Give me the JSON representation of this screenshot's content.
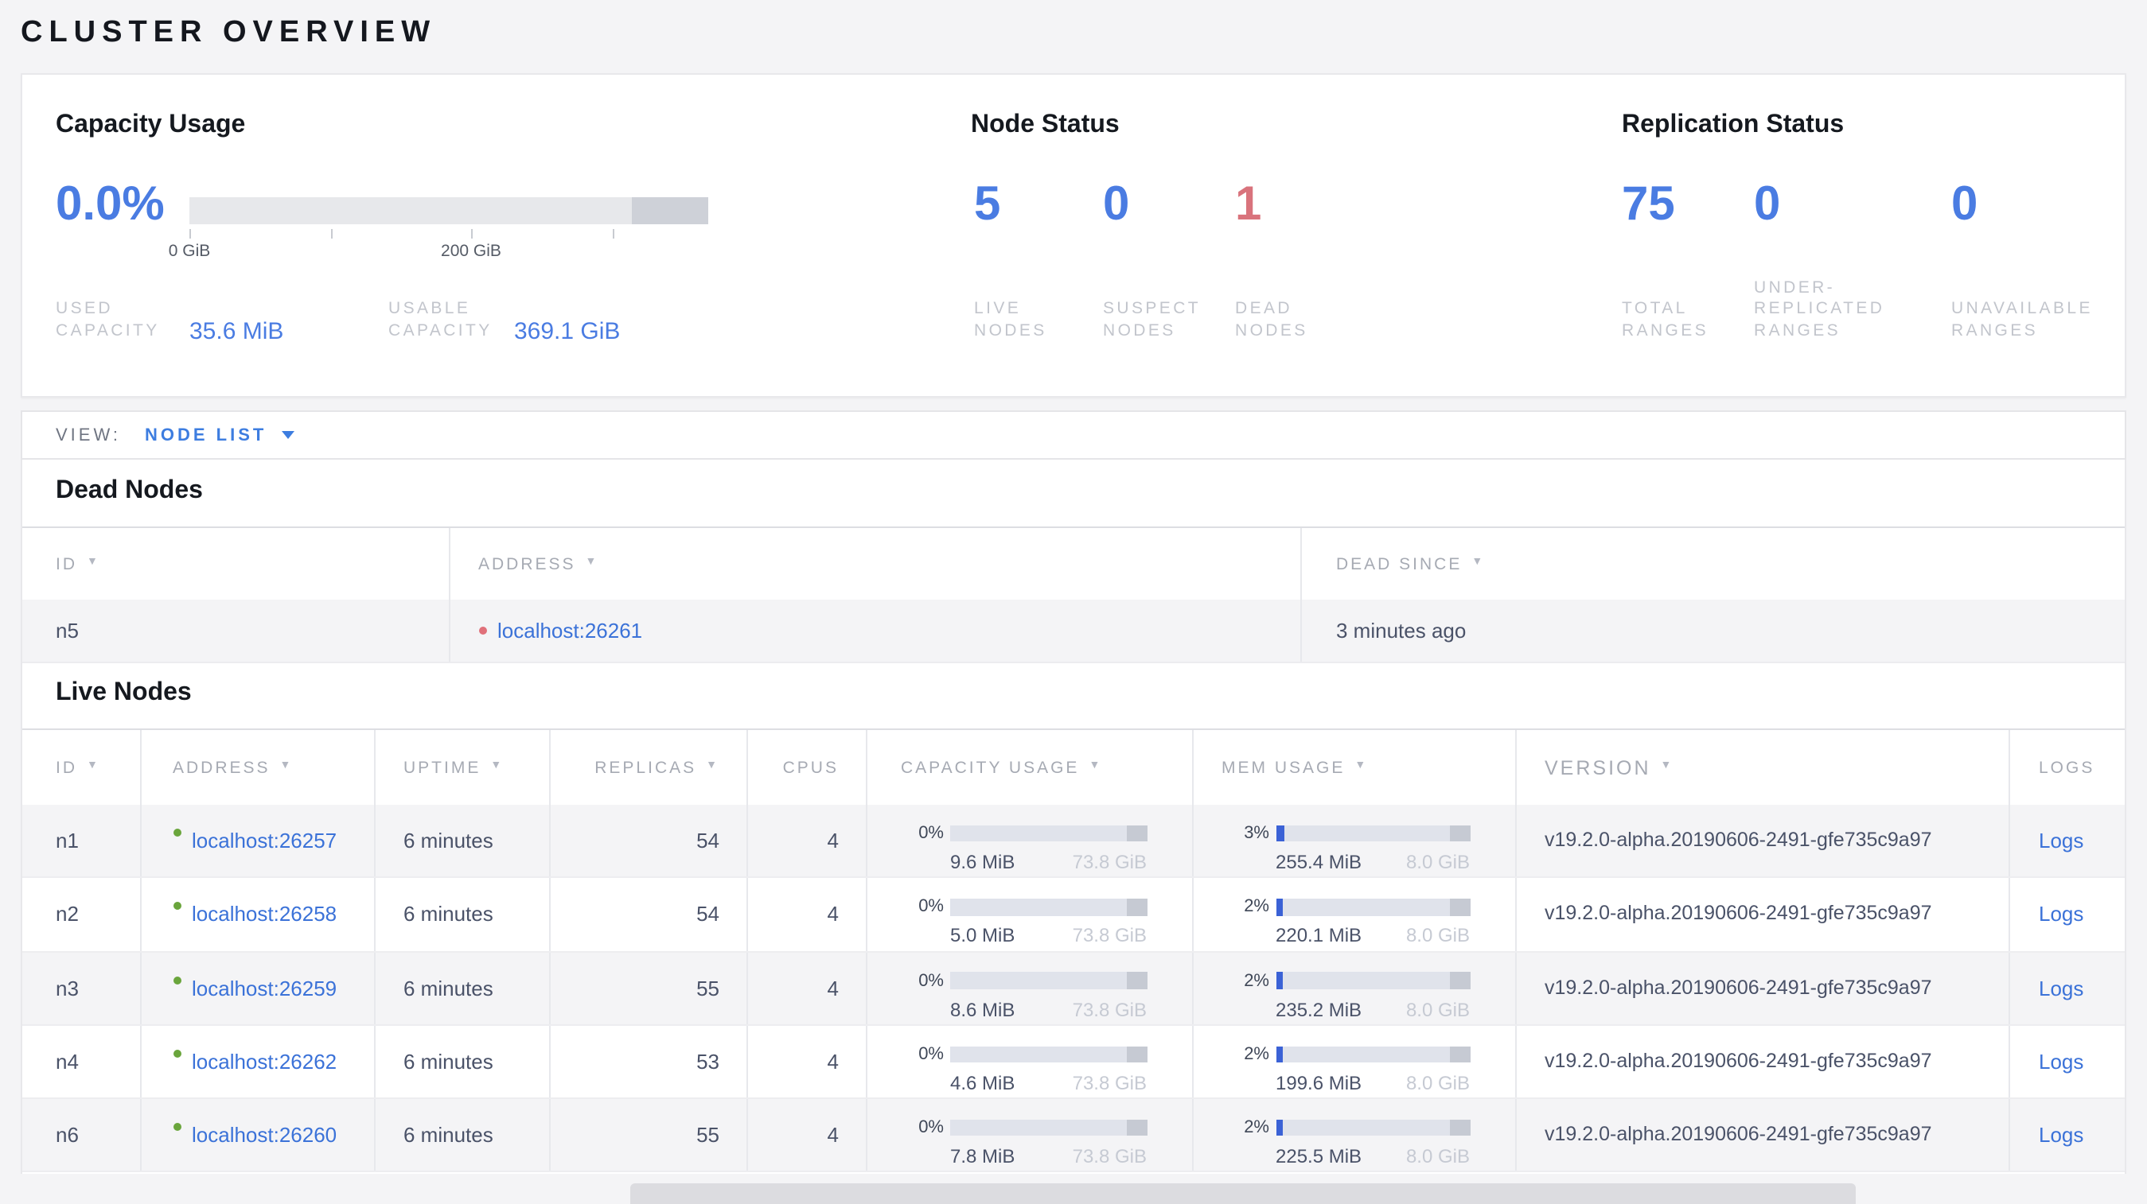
{
  "page": {
    "title": "CLUSTER OVERVIEW"
  },
  "colors": {
    "accent_blue": "#4a7ce2",
    "link_blue": "#3b72d8",
    "danger_red": "#d9737c",
    "live_green": "#6aa53c",
    "dead_dot_red": "#e0707a"
  },
  "summary": {
    "capacity": {
      "title": "Capacity Usage",
      "percent": "0.0%",
      "tick_labels": [
        "0 GiB",
        "200 GiB"
      ],
      "used": {
        "label": "USED\nCAPACITY",
        "value": "35.6 MiB"
      },
      "usable": {
        "label": "USABLE\nCAPACITY",
        "value": "369.1 GiB"
      }
    },
    "node_status": {
      "title": "Node Status",
      "stats": [
        {
          "value": "5",
          "label": "LIVE\nNODES"
        },
        {
          "value": "0",
          "label": "SUSPECT\nNODES"
        },
        {
          "value": "1",
          "label": "DEAD\nNODES"
        }
      ]
    },
    "replication": {
      "title": "Replication Status",
      "stats": [
        {
          "value": "75",
          "label": "TOTAL\nRANGES"
        },
        {
          "value": "0",
          "label": "UNDER-\nREPLICATED\nRANGES"
        },
        {
          "value": "0",
          "label": "UNAVAILABLE\nRANGES"
        }
      ]
    }
  },
  "view_bar": {
    "label": "VIEW:",
    "selected": "NODE LIST"
  },
  "dead_nodes": {
    "title": "Dead Nodes",
    "columns": [
      {
        "label": "ID"
      },
      {
        "label": "ADDRESS"
      },
      {
        "label": "DEAD SINCE"
      }
    ],
    "rows": [
      {
        "id": "n5",
        "address": "localhost:26261",
        "dead_since": "3 minutes ago"
      }
    ]
  },
  "live_nodes": {
    "title": "Live Nodes",
    "columns": [
      {
        "label": "ID"
      },
      {
        "label": "ADDRESS"
      },
      {
        "label": "UPTIME"
      },
      {
        "label": "REPLICAS"
      },
      {
        "label": "CPUS"
      },
      {
        "label": "CAPACITY USAGE"
      },
      {
        "label": "MEM USAGE"
      },
      {
        "label": "VERSION"
      },
      {
        "label": "LOGS"
      }
    ],
    "rows": [
      {
        "id": "n1",
        "address": "localhost:26257",
        "uptime": "6 minutes",
        "replicas": "54",
        "cpus": "4",
        "capacity": {
          "percent": "0%",
          "used": "9.6 MiB",
          "total": "73.8 GiB",
          "frac": 0
        },
        "memory": {
          "percent": "3%",
          "used": "255.4 MiB",
          "total": "8.0 GiB",
          "frac": 0.045
        },
        "version": "v19.2.0-alpha.20190606-2491-gfe735c9a97",
        "logs_label": "Logs"
      },
      {
        "id": "n2",
        "address": "localhost:26258",
        "uptime": "6 minutes",
        "replicas": "54",
        "cpus": "4",
        "capacity": {
          "percent": "0%",
          "used": "5.0 MiB",
          "total": "73.8 GiB",
          "frac": 0
        },
        "memory": {
          "percent": "2%",
          "used": "220.1 MiB",
          "total": "8.0 GiB",
          "frac": 0.04
        },
        "version": "v19.2.0-alpha.20190606-2491-gfe735c9a97",
        "logs_label": "Logs"
      },
      {
        "id": "n3",
        "address": "localhost:26259",
        "uptime": "6 minutes",
        "replicas": "55",
        "cpus": "4",
        "capacity": {
          "percent": "0%",
          "used": "8.6 MiB",
          "total": "73.8 GiB",
          "frac": 0
        },
        "memory": {
          "percent": "2%",
          "used": "235.2 MiB",
          "total": "8.0 GiB",
          "frac": 0.04
        },
        "version": "v19.2.0-alpha.20190606-2491-gfe735c9a97",
        "logs_label": "Logs"
      },
      {
        "id": "n4",
        "address": "localhost:26262",
        "uptime": "6 minutes",
        "replicas": "53",
        "cpus": "4",
        "capacity": {
          "percent": "0%",
          "used": "4.6 MiB",
          "total": "73.8 GiB",
          "frac": 0
        },
        "memory": {
          "percent": "2%",
          "used": "199.6 MiB",
          "total": "8.0 GiB",
          "frac": 0.04
        },
        "version": "v19.2.0-alpha.20190606-2491-gfe735c9a97",
        "logs_label": "Logs"
      },
      {
        "id": "n6",
        "address": "localhost:26260",
        "uptime": "6 minutes",
        "replicas": "55",
        "cpus": "4",
        "capacity": {
          "percent": "0%",
          "used": "7.8 MiB",
          "total": "73.8 GiB",
          "frac": 0
        },
        "memory": {
          "percent": "2%",
          "used": "225.5 MiB",
          "total": "8.0 GiB",
          "frac": 0.04
        },
        "version": "v19.2.0-alpha.20190606-2491-gfe735c9a97",
        "logs_label": "Logs"
      }
    ]
  }
}
